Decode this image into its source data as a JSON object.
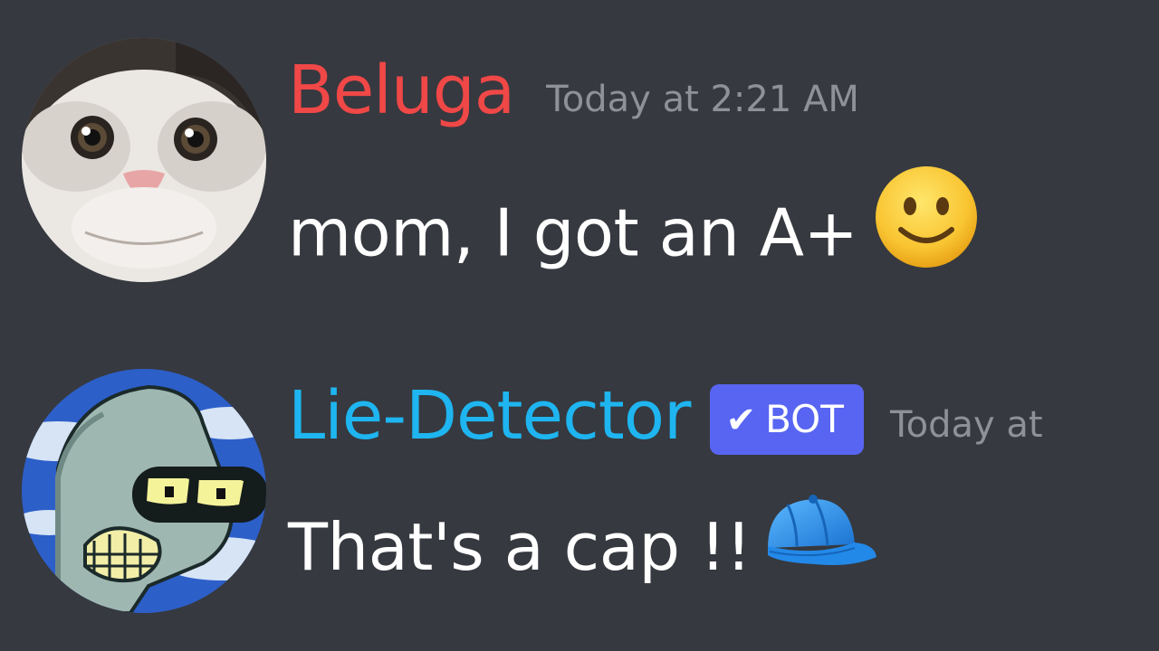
{
  "messages": [
    {
      "username": "Beluga",
      "username_color": "#f04747",
      "timestamp": "Today at 2:21 AM",
      "text": "mom, I got an A+",
      "emoji": "slightly-smiling-face-icon",
      "avatar": "beluga-cat-avatar"
    },
    {
      "username": "Lie-Detector",
      "username_color": "#1eb5f0",
      "badge": {
        "check": "✔",
        "label": "BOT",
        "color": "#5865f2"
      },
      "timestamp": "Today at",
      "text": "That's a cap !!",
      "emoji": "blue-cap-icon",
      "avatar": "bender-avatar"
    }
  ],
  "colors": {
    "background": "#36393f",
    "timestamp": "#8e9297",
    "text": "#ffffff"
  }
}
